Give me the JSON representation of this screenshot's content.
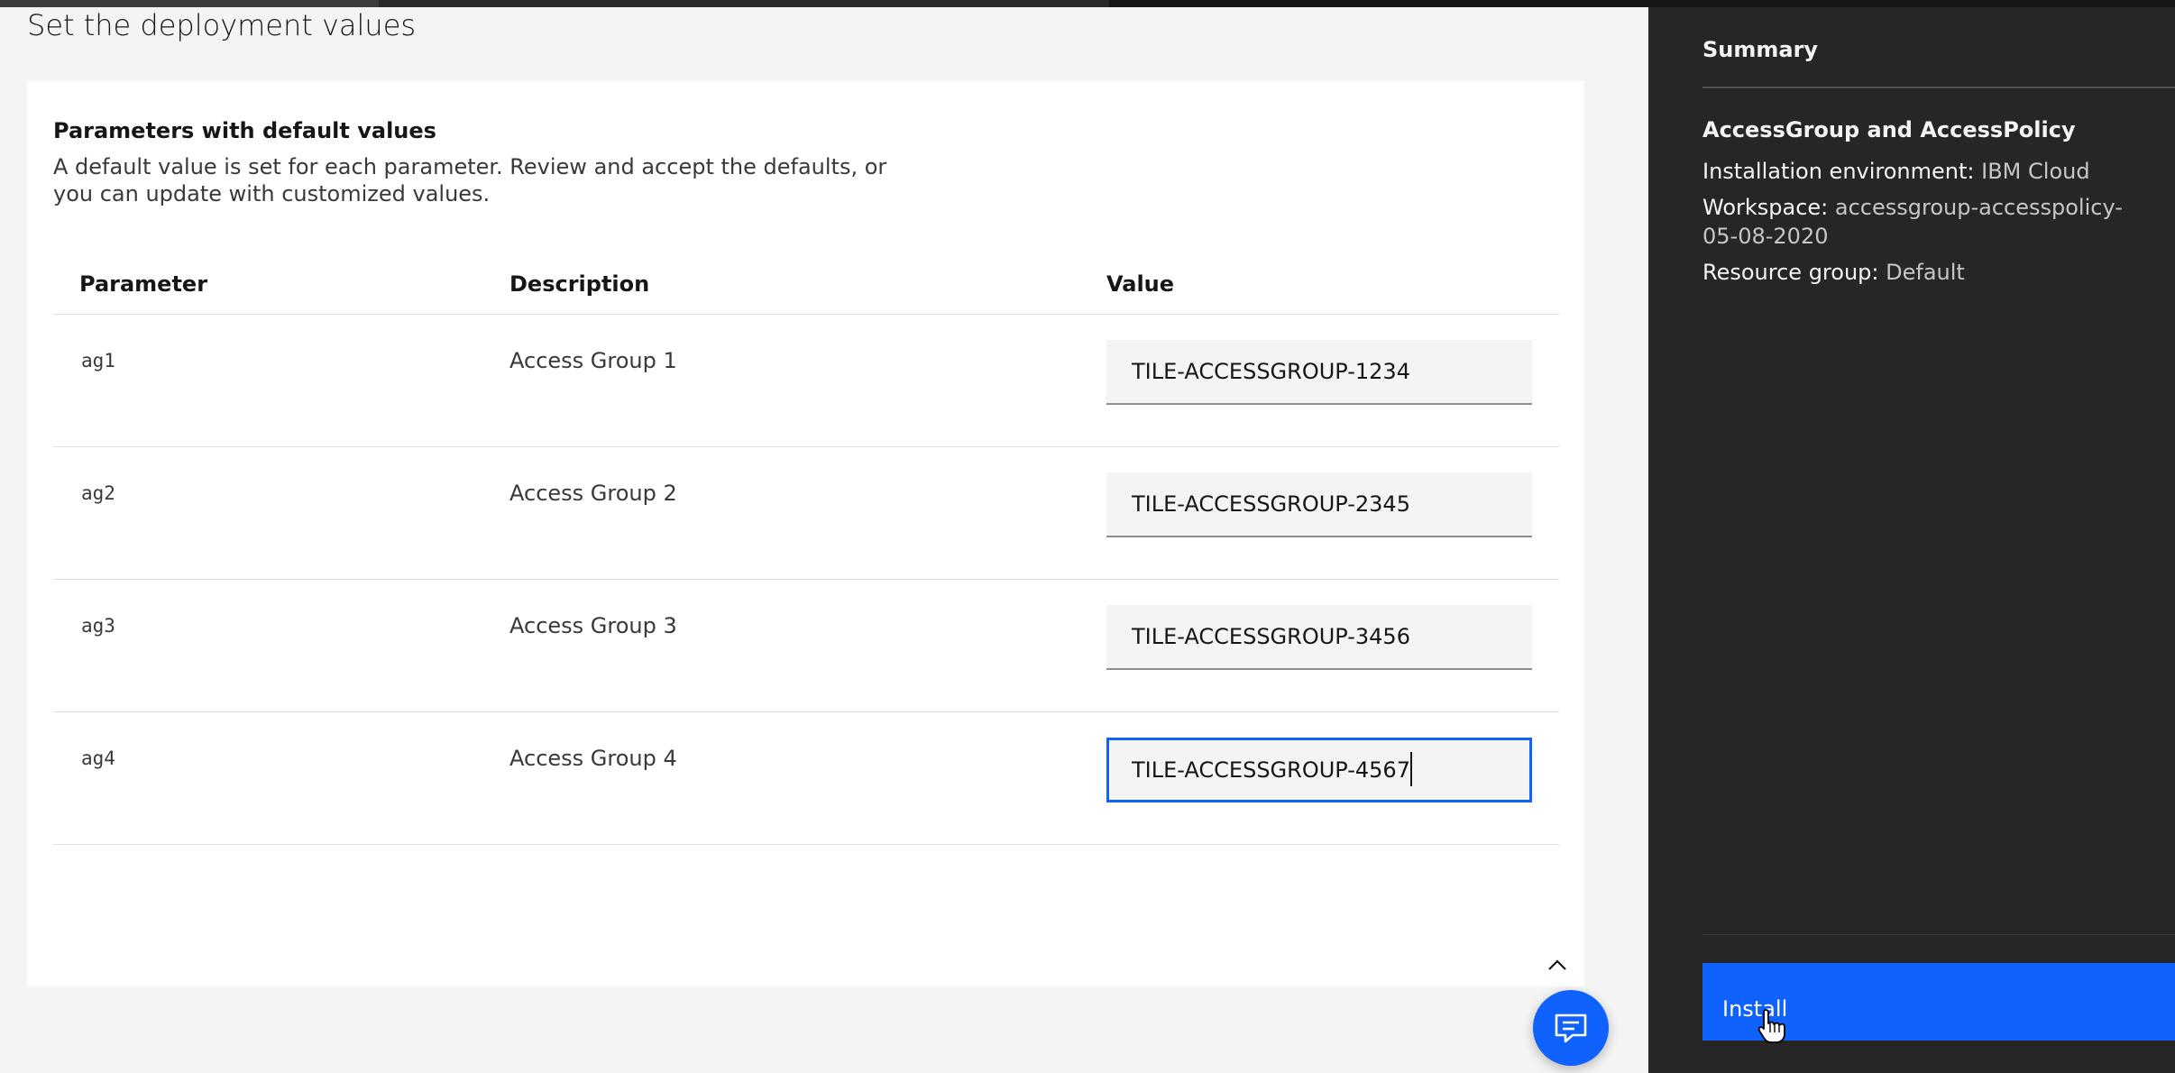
{
  "page": {
    "heading": "Set the deployment values"
  },
  "parameters_card": {
    "title": "Parameters with default values",
    "description": "A default value is set for each parameter. Review and accept the defaults, or you can update with customized values.",
    "columns": {
      "parameter": "Parameter",
      "description": "Description",
      "value": "Value"
    },
    "rows": [
      {
        "parameter": "ag1",
        "description": "Access Group 1",
        "value": "TILE-ACCESSGROUP-1234"
      },
      {
        "parameter": "ag2",
        "description": "Access Group 2",
        "value": "TILE-ACCESSGROUP-2345"
      },
      {
        "parameter": "ag3",
        "description": "Access Group 3",
        "value": "TILE-ACCESSGROUP-3456"
      },
      {
        "parameter": "ag4",
        "description": "Access Group 4",
        "value": "TILE-ACCESSGROUP-4567"
      }
    ],
    "focused_row": 3
  },
  "summary": {
    "title": "Summary",
    "product": "AccessGroup and AccessPolicy",
    "installation_environment_label": "Installation environment:",
    "installation_environment_value": "IBM Cloud",
    "workspace_label": "Workspace:",
    "workspace_value": "accessgroup-accesspolicy-05-08-2020",
    "resource_group_label": "Resource group:",
    "resource_group_value": "Default",
    "install_label": "Install"
  },
  "icons": {
    "collapse": "chevron-up-icon",
    "chat": "chat-icon",
    "cursor": "hand-pointer-cursor"
  },
  "colors": {
    "primary": "#0f62fe",
    "sidebar_bg": "#262626",
    "page_bg": "#f4f4f4",
    "card_bg": "#ffffff"
  }
}
